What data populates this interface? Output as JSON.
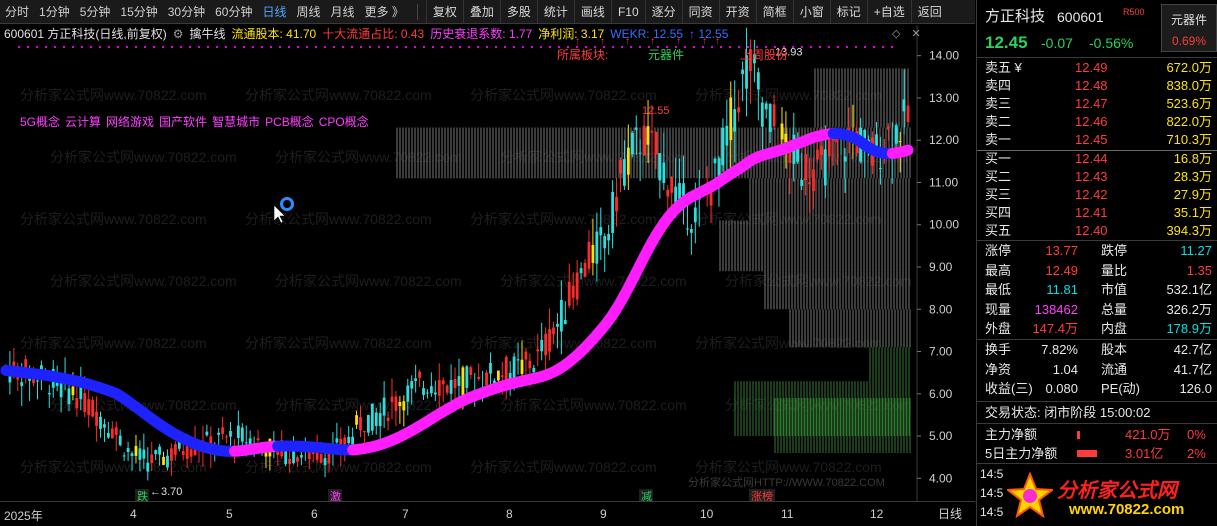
{
  "toolbar": {
    "periods": [
      "分时",
      "1分钟",
      "5分钟",
      "15分钟",
      "30分钟",
      "60分钟",
      "日线",
      "周线",
      "月线",
      "更多 》"
    ],
    "active_period": "日线",
    "buttons": [
      "复权",
      "叠加",
      "多股",
      "统计",
      "画线",
      "F10",
      "逐分",
      "同资",
      "开资",
      "简框",
      "小窗",
      "标记",
      "+自选",
      "返回"
    ]
  },
  "info": {
    "code_name": "600601 方正科技(日线,前复权)",
    "indicator": "擒牛线",
    "float_shares": "流通股本: 41.70",
    "top10_ratio": "十大流通占比: 0.43",
    "history_coef": "历史衰退系数: 1.77",
    "net_profit": "净利润: 3.17",
    "wekr": "WEKR: 12.55",
    "arrow_value": "↑ 12.55",
    "concepts": [
      "5G概念",
      "云计算",
      "网络游戏",
      "国产软件",
      "智慧城市",
      "PCB概念",
      "CPO概念"
    ],
    "sector_tag": "所属板块:",
    "sector_name": "元器件",
    "list_tag": "上周股份",
    "watermark": "分析家公式网www.70822.com",
    "bottom_watermark": "分析家公式网HTTP://WWW.70822.COM",
    "bottom_labels": [
      "跌",
      "激",
      "减",
      "涨榜"
    ],
    "low_label": "←3.70",
    "peak_label": "12.55",
    "high_label": "13.93"
  },
  "chart_data": {
    "type": "candlestick",
    "x_ticks": [
      "2025年",
      "4",
      "5",
      "6",
      "7",
      "8",
      "9",
      "10",
      "11",
      "12"
    ],
    "y_ticks": [
      "14.00",
      "13.00",
      "12.00",
      "11.00",
      "10.00",
      "9.00",
      "8.00",
      "7.00",
      "6.00",
      "5.00",
      "4.00"
    ],
    "ylim": [
      3.7,
      14.3
    ],
    "period": "日线",
    "annotations": [
      {
        "label": "←3.70",
        "value": 3.7
      },
      {
        "label": "12.55",
        "value": 12.55
      },
      {
        "label": "13.93",
        "value": 13.93
      }
    ],
    "close_series": [
      6.6,
      6.5,
      6.4,
      6.2,
      6.0,
      5.6,
      5.2,
      4.6,
      4.4,
      4.5,
      4.7,
      4.8,
      4.9,
      5.0,
      4.9,
      4.7,
      4.6,
      4.6,
      4.6,
      4.7,
      5.3,
      5.5,
      5.8,
      6.1,
      6.3,
      6.2,
      6.3,
      6.4,
      6.5,
      6.6,
      6.8,
      7.5,
      8.4,
      9.2,
      9.8,
      11.5,
      12.1,
      11.5,
      10.6,
      10.2,
      11.0,
      12.5,
      13.9,
      12.6,
      11.9,
      11.4,
      11.3,
      11.8,
      12.1,
      11.6,
      12.2,
      12.45
    ]
  },
  "panel": {
    "stock_name": "方正科技",
    "stock_code": "600601",
    "r_badge": "R500",
    "sector_box": "元器件",
    "sector_pct": "0.69%",
    "price": "12.45",
    "change": "-0.07",
    "change_pct": "-0.56%",
    "asks": [
      {
        "label": "卖五 ¥",
        "price": "12.49",
        "vol": "672.0万"
      },
      {
        "label": "卖四",
        "price": "12.48",
        "vol": "838.0万"
      },
      {
        "label": "卖三",
        "price": "12.47",
        "vol": "523.6万"
      },
      {
        "label": "卖二",
        "price": "12.46",
        "vol": "822.0万"
      },
      {
        "label": "卖一",
        "price": "12.45",
        "vol": "710.3万"
      }
    ],
    "bids": [
      {
        "label": "买一",
        "price": "12.44",
        "vol": "16.8万"
      },
      {
        "label": "买二",
        "price": "12.43",
        "vol": "28.3万"
      },
      {
        "label": "买三",
        "price": "12.42",
        "vol": "27.9万"
      },
      {
        "label": "买四",
        "price": "12.41",
        "vol": "35.1万"
      },
      {
        "label": "买五",
        "price": "12.40",
        "vol": "394.3万"
      }
    ],
    "stats": [
      {
        "l1": "涨停",
        "v1": "13.77",
        "l2": "跌停",
        "v2": "11.27"
      },
      {
        "l1": "最高",
        "v1": "12.49",
        "l2": "量比",
        "v2": "1.35"
      },
      {
        "l1": "最低",
        "v1": "11.81",
        "l2": "市值",
        "v2": "532.1亿"
      },
      {
        "l1": "现量",
        "v1": "138462",
        "l2": "总量",
        "v2": "326.2万"
      },
      {
        "l1": "外盘",
        "v1": "147.4万",
        "l2": "内盘",
        "v2": "178.9万"
      }
    ],
    "stats2": [
      {
        "l1": "换手",
        "v1": "7.82%",
        "l2": "股本",
        "v2": "42.7亿"
      },
      {
        "l1": "净资",
        "v1": "1.04",
        "l2": "流通",
        "v2": "41.7亿"
      },
      {
        "l1": "收益(三)",
        "v1": "0.080",
        "l2": "PE(动)",
        "v2": "126.0"
      }
    ],
    "trade_status": "交易状态: 闭市阶段 15:00:02",
    "main_net_label": "主力净额",
    "main_net_value": "421.0万",
    "main_net_pct": "0%",
    "five_day_label": "5日主力净额",
    "five_day_value": "3.01亿",
    "five_day_pct": "2%",
    "tick_times": [
      "14:5",
      "14:5",
      "14:5"
    ],
    "logo_text": "分析家公式网",
    "logo_url": "www.70822.com",
    "period_label": "日线"
  }
}
